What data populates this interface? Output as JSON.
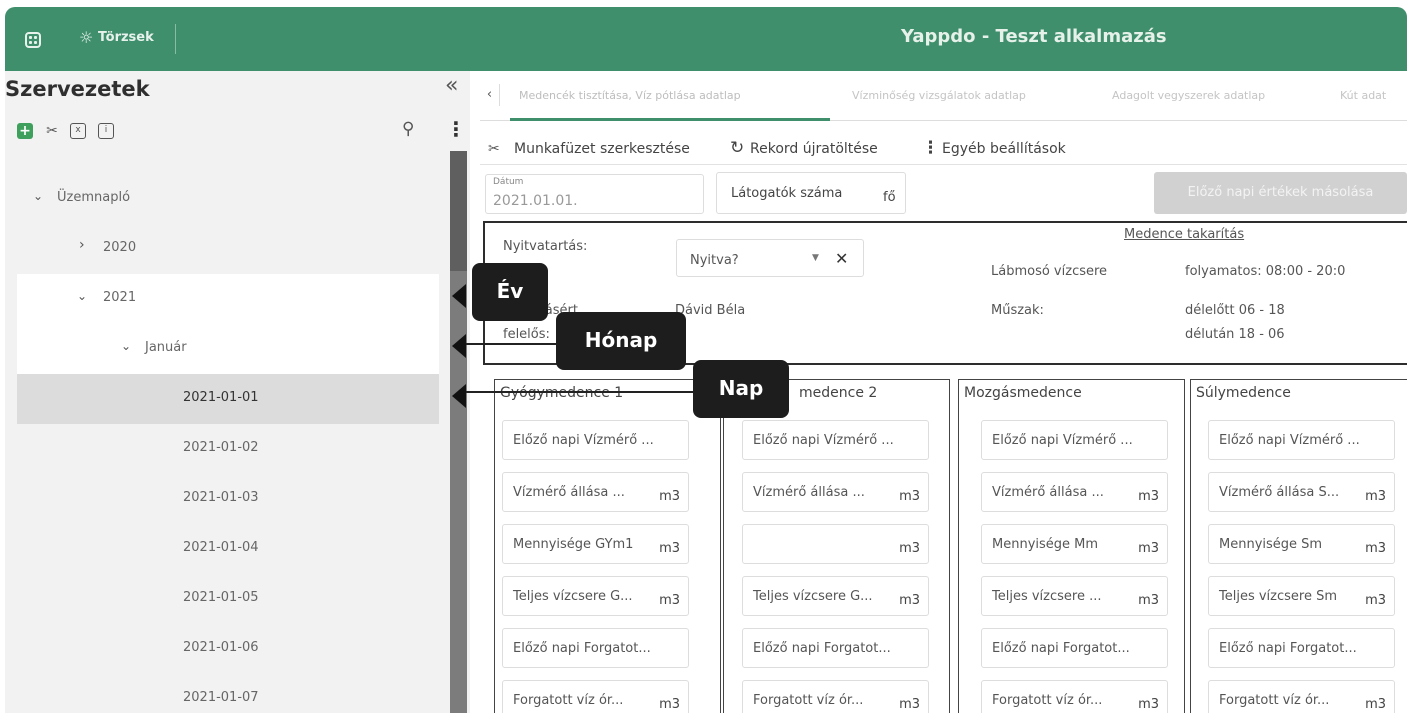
{
  "topbar": {
    "section": "Törzsek",
    "app_title": "Yappdo - Teszt alkalmazás"
  },
  "sidebar": {
    "title": "Szervezetek",
    "collapse": "«",
    "tree": [
      {
        "label": "Üzemnapló",
        "chevron": "⌄"
      },
      {
        "label": "2020",
        "chevron": "›"
      },
      {
        "label": "2021",
        "chevron": "⌄"
      },
      {
        "label": "Január",
        "chevron": "⌄"
      },
      {
        "label": "2021-01-01"
      },
      {
        "label": "2021-01-02"
      },
      {
        "label": "2021-01-03"
      },
      {
        "label": "2021-01-04"
      },
      {
        "label": "2021-01-05"
      },
      {
        "label": "2021-01-06"
      },
      {
        "label": "2021-01-07"
      }
    ]
  },
  "callouts": {
    "ev": "Év",
    "honap": "Hónap",
    "nap": "Nap"
  },
  "tabs": [
    "Medencék tisztítása, Víz pótlása adatlap",
    "Vízminőség vizsgálatok adatlap",
    "Adagolt vegyszerek adatlap",
    "Kút adat"
  ],
  "actions": {
    "edit": "Munkafüzet szerkesztése",
    "reload": "Rekord újratöltése",
    "other": "Egyéb beállítások"
  },
  "form": {
    "date_label": "Dátum",
    "date_value": "2021.01.01.",
    "visitors_label": "Látogatók száma",
    "visitors_unit": "fő",
    "copy_button": "Előző napi értékek másolása"
  },
  "info": {
    "opening_label": "Nyitvatartás:",
    "opening_value": "Nyitva?",
    "responsible_label_1": "Irányításért",
    "responsible_label_2": "felelős:",
    "responsible_value": "Dávid Béla",
    "cleaning_link": "Medence takarítás",
    "footbath_label": "Lábmosó vízcsere",
    "footbath_value": "folyamatos: 08:00 - 20:0",
    "shift_label": "Műszak:",
    "shift_morning": "délelőtt 06 - 18",
    "shift_afternoon": "délután 18 - 06"
  },
  "pools": [
    {
      "name": "Gyógymedence 1",
      "fields": [
        {
          "label": "Előző napi Vízmérő ...",
          "unit": ""
        },
        {
          "label": "Vízmérő állása ...",
          "unit": "m3"
        },
        {
          "label": "Mennyisége GYm1",
          "unit": "m3"
        },
        {
          "label": "Teljes vízcsere G...",
          "unit": "m3"
        },
        {
          "label": "Előző napi Forgatot...",
          "unit": ""
        },
        {
          "label": "Forgatott víz ór...",
          "unit": "m3"
        }
      ]
    },
    {
      "name": "medence 2",
      "fields": [
        {
          "label": "Előző napi Vízmérő ...",
          "unit": ""
        },
        {
          "label": "Vízmérő állása ...",
          "unit": "m3"
        },
        {
          "label": "",
          "unit": "m3"
        },
        {
          "label": "Teljes vízcsere G...",
          "unit": "m3"
        },
        {
          "label": "Előző napi Forgatot...",
          "unit": ""
        },
        {
          "label": "Forgatott víz ór...",
          "unit": "m3"
        }
      ]
    },
    {
      "name": "Mozgásmedence",
      "fields": [
        {
          "label": "Előző napi Vízmérő ...",
          "unit": ""
        },
        {
          "label": "Vízmérő állása ...",
          "unit": "m3"
        },
        {
          "label": "Mennyisége Mm",
          "unit": "m3"
        },
        {
          "label": "Teljes vízcsere ...",
          "unit": "m3"
        },
        {
          "label": "Előző napi Forgatot...",
          "unit": ""
        },
        {
          "label": "Forgatott víz ór...",
          "unit": "m3"
        }
      ]
    },
    {
      "name": "Súlymedence",
      "fields": [
        {
          "label": "Előző napi Vízmérő ...",
          "unit": ""
        },
        {
          "label": "Vízmérő állása S...",
          "unit": "m3"
        },
        {
          "label": "Mennyisége Sm",
          "unit": "m3"
        },
        {
          "label": "Teljes vízcsere Sm",
          "unit": "m3"
        },
        {
          "label": "Előző napi Forgatot...",
          "unit": ""
        },
        {
          "label": "Forgatott víz ór...",
          "unit": "m3"
        }
      ]
    }
  ],
  "colors": {
    "header": "#3f8f6c",
    "callout": "#1d1d1d"
  }
}
